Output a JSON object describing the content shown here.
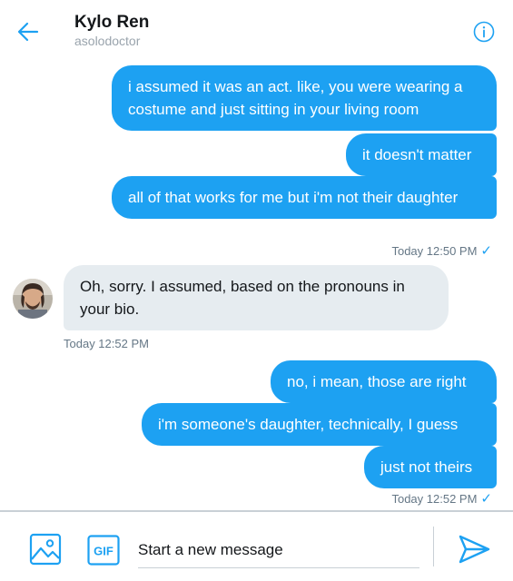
{
  "header": {
    "title": "Kylo Ren",
    "handle": "asolodoctor",
    "back_icon": "arrow-left-icon",
    "info_icon": "info-circle-icon"
  },
  "messages": [
    {
      "direction": "out",
      "text": "i assumed it was an act. like, you were wearing a costume and just sitting in your living room"
    },
    {
      "direction": "out",
      "text": "it doesn't matter"
    },
    {
      "direction": "out",
      "text": "all of that works for me but i'm not their daughter"
    },
    {
      "direction": "out",
      "text": "no, i mean, those are right"
    },
    {
      "direction": "out",
      "text": "i'm someone's daughter, technically, I guess"
    },
    {
      "direction": "out",
      "text": "just not theirs"
    }
  ],
  "incoming": {
    "text": "Oh, sorry. I assumed, based on the pronouns in your bio.",
    "time": "Today 12:52 PM"
  },
  "meta": {
    "group1_time": "Today 12:50 PM",
    "group2_time": "Today 12:52 PM",
    "check_glyph": "✓"
  },
  "composer": {
    "placeholder": "Start a new message",
    "media_icon": "image-icon",
    "gif_label": "GIF",
    "send_icon": "send-icon"
  },
  "colors": {
    "accent": "#1da1f2",
    "incoming_bubble": "#e6ecf0",
    "muted_text": "#657786"
  }
}
